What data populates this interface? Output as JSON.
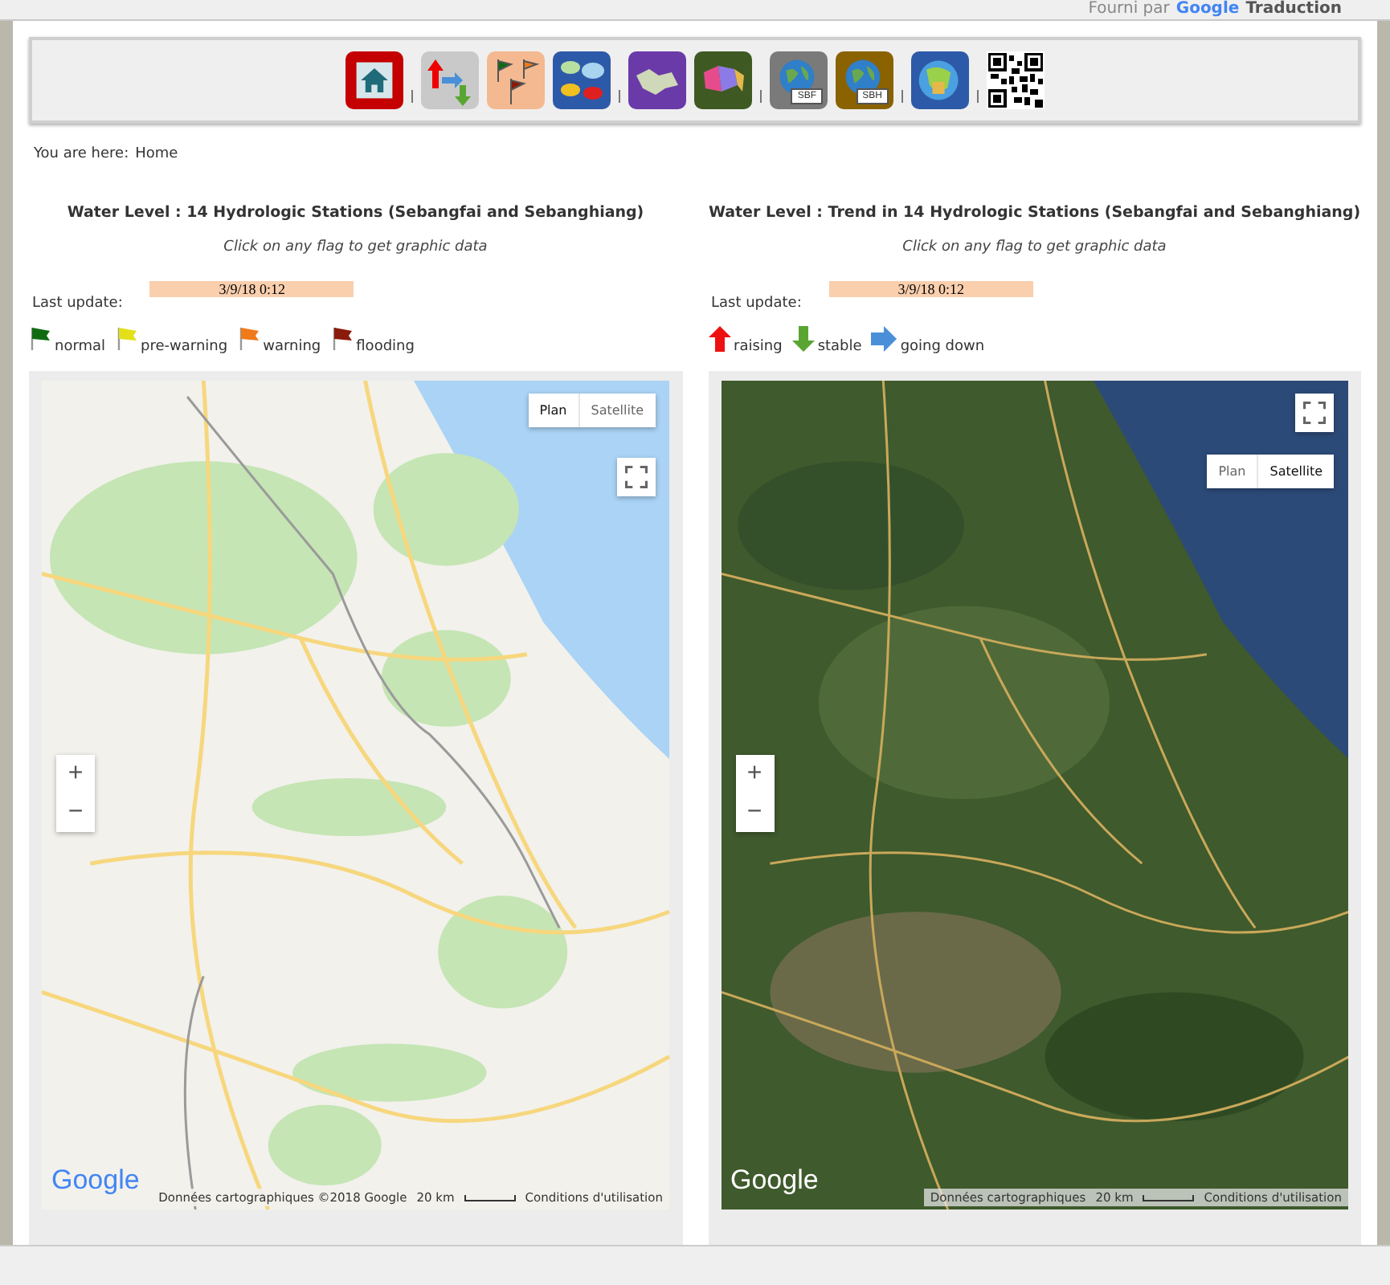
{
  "top_bar": {
    "credit_prefix": "Fourni par",
    "credit_brand": "Google",
    "credit_suffix": "Traduction"
  },
  "toolbar": {
    "groups": [
      [
        {
          "kind": "home"
        }
      ],
      [
        {
          "kind": "trend-arrows"
        },
        {
          "kind": "flags"
        },
        {
          "kind": "bubbles"
        }
      ],
      [
        {
          "kind": "purple-map"
        },
        {
          "kind": "colored-map"
        }
      ],
      [
        {
          "kind": "globe",
          "label": "SBF",
          "color": "#7a7a7a"
        },
        {
          "kind": "globe",
          "label": "SBH",
          "color": "#8a6200"
        }
      ],
      [
        {
          "kind": "globe-map"
        }
      ],
      [
        {
          "kind": "qr"
        }
      ]
    ]
  },
  "breadcrumb": {
    "prefix": "You are here:",
    "current": "Home"
  },
  "panels": [
    {
      "title": "Water Level : 14 Hydrologic Stations (Sebangfai and Sebanghiang)",
      "hint": "Click on any flag to get graphic data",
      "update_label": "Last update:",
      "update_value": "3/9/18 0:12",
      "legend": [
        {
          "kind": "flag",
          "label": "normal",
          "color": "#0f6b12"
        },
        {
          "kind": "flag",
          "label": "pre-warning",
          "color": "#e3e01a"
        },
        {
          "kind": "flag",
          "label": "warning",
          "color": "#f07a1a"
        },
        {
          "kind": "flag",
          "label": "flooding",
          "color": "#8a1a0a"
        }
      ],
      "map": {
        "kind": "plan",
        "types": [
          {
            "label": "Plan",
            "selected": true
          },
          {
            "label": "Satellite",
            "selected": false
          }
        ],
        "zoom_in": "+",
        "zoom_out": "−",
        "logo": "Google",
        "attribution": "Données cartographiques ©2018 Google",
        "scale": "20 km",
        "terms": "Conditions d'utilisation"
      }
    },
    {
      "title": "Water Level : Trend in 14 Hydrologic Stations (Sebangfai and Sebanghiang)",
      "hint": "Click on any flag to get graphic data",
      "update_label": "Last update:",
      "update_value": "3/9/18 0:12",
      "legend": [
        {
          "kind": "arrow-up",
          "label": "raising",
          "color": "#ee1111"
        },
        {
          "kind": "arrow-down",
          "label": "stable",
          "color": "#5aa532"
        },
        {
          "kind": "arrow-right",
          "label": "going down",
          "color": "#4a90d9"
        }
      ],
      "map": {
        "kind": "satellite",
        "types": [
          {
            "label": "Plan",
            "selected": false
          },
          {
            "label": "Satellite",
            "selected": true
          }
        ],
        "zoom_in": "+",
        "zoom_out": "−",
        "logo": "Google",
        "attribution": "Données cartographiques",
        "scale": "20 km",
        "terms": "Conditions d'utilisation"
      }
    }
  ]
}
